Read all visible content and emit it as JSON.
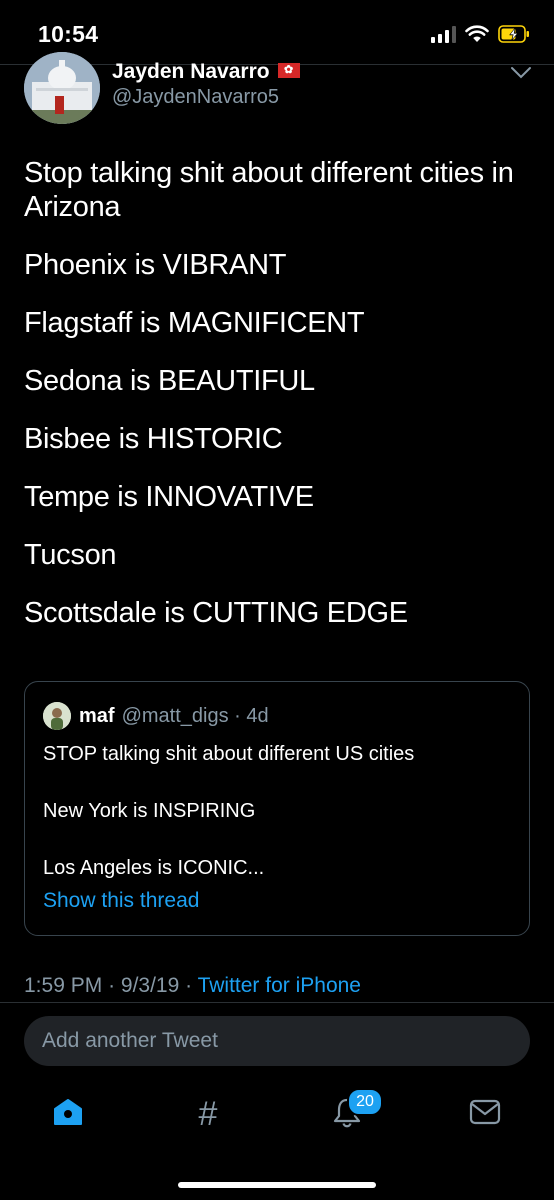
{
  "status_bar": {
    "time": "10:54"
  },
  "tweet": {
    "author_name": "Jayden Navarro",
    "author_handle": "@JaydenNavarro5",
    "lines": [
      "Stop talking shit about different cities in Arizona",
      "Phoenix is VIBRANT",
      "Flagstaff is MAGNIFICENT",
      "Sedona is BEAUTIFUL",
      "Bisbee is HISTORIC",
      "Tempe is INNOVATIVE",
      "Tucson",
      "Scottsdale is CUTTING EDGE"
    ],
    "time": "1:59 PM",
    "date": "9/3/19",
    "source": "Twitter for iPhone"
  },
  "quoted_tweet": {
    "name": "maf",
    "handle": "@matt_digs",
    "age": "4d",
    "lines": [
      "STOP talking shit about different US cities",
      "New York is INSPIRING",
      "Los Angeles is ICONIC..."
    ],
    "show_thread": "Show this thread"
  },
  "reply": {
    "placeholder": "Add another Tweet"
  },
  "tab_bar": {
    "notification_count": "20"
  },
  "icons": {
    "home": "home-icon",
    "search": "hashtag-icon",
    "notifications": "bell-icon",
    "messages": "mail-icon",
    "menu": "chevron-down-icon"
  },
  "colors": {
    "accent": "#1da1f2",
    "secondary_text": "#8899a6",
    "battery": "#ffd60a"
  }
}
